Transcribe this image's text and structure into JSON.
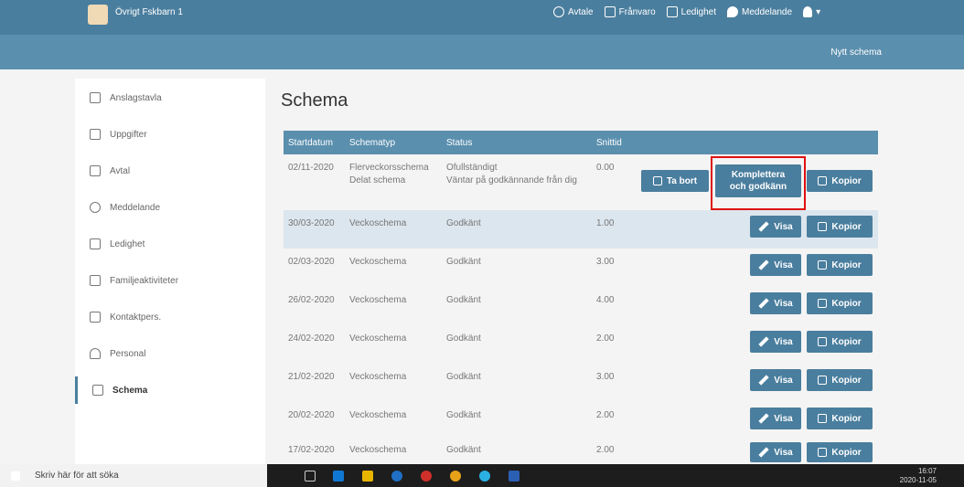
{
  "topbar": {
    "child_name": "Övrigt Fskbarn 1",
    "nav": [
      {
        "label": "Avtale",
        "icon": "clock-icon"
      },
      {
        "label": "Frånvaro",
        "icon": "calendar-x-icon"
      },
      {
        "label": "Ledighet",
        "icon": "calendar-icon"
      },
      {
        "label": "Meddelande",
        "icon": "speech-bubble-icon"
      }
    ],
    "user_icon": "user-icon"
  },
  "subbar": {
    "new_label": "Nytt schema"
  },
  "sidebar": {
    "items": [
      {
        "label": "Anslagstavla",
        "icon": "pin-icon"
      },
      {
        "label": "Uppgifter",
        "icon": "list-icon"
      },
      {
        "label": "Avtal",
        "icon": "calendar-icon"
      },
      {
        "label": "Meddelande",
        "icon": "speech-bubble-icon"
      },
      {
        "label": "Ledighet",
        "icon": "calendar-x-icon"
      },
      {
        "label": "Familjeaktiviteter",
        "icon": "family-icon"
      },
      {
        "label": "Kontaktpers.",
        "icon": "contacts-icon"
      },
      {
        "label": "Personal",
        "icon": "person-icon"
      },
      {
        "label": "Schema",
        "icon": "table-icon"
      }
    ]
  },
  "page_title": "Schema",
  "table": {
    "headers": [
      "Startdatum",
      "Schematyp",
      "Status",
      "Snittid"
    ],
    "rows": [
      {
        "date": "02/11-2020",
        "type": "Flerveckorsschema",
        "type2": "Delat schema",
        "status": "Ofullständigt",
        "status2": "Väntar på godkännande från dig",
        "avg": "0.00"
      },
      {
        "date": "30/03-2020",
        "type": "Veckoschema",
        "type2": "",
        "status": "Godkänt",
        "status2": "",
        "avg": "1.00"
      },
      {
        "date": "02/03-2020",
        "type": "Veckoschema",
        "type2": "",
        "status": "Godkänt",
        "status2": "",
        "avg": "3.00"
      },
      {
        "date": "26/02-2020",
        "type": "Veckoschema",
        "type2": "",
        "status": "Godkänt",
        "status2": "",
        "avg": "4.00"
      },
      {
        "date": "24/02-2020",
        "type": "Veckoschema",
        "type2": "",
        "status": "Godkänt",
        "status2": "",
        "avg": "2.00"
      },
      {
        "date": "21/02-2020",
        "type": "Veckoschema",
        "type2": "",
        "status": "Godkänt",
        "status2": "",
        "avg": "3.00"
      },
      {
        "date": "20/02-2020",
        "type": "Veckoschema",
        "type2": "",
        "status": "Godkänt",
        "status2": "",
        "avg": "2.00"
      },
      {
        "date": "17/02-2020",
        "type": "Veckoschema",
        "type2": "",
        "status": "Godkänt",
        "status2": "",
        "avg": "2.00"
      }
    ],
    "buttons": {
      "delete": "Ta bort",
      "complete_line1": "Komplettera",
      "complete_line2": "och godkänn",
      "copy": "Kopior",
      "view": "Visa"
    }
  },
  "taskbar": {
    "search_placeholder": "Skriv här för att söka",
    "time": "16:07",
    "date": "2020-11-05"
  },
  "colors": {
    "primary": "#4a7e9e",
    "header": "#5b8fae",
    "highlight": "#e01010"
  }
}
